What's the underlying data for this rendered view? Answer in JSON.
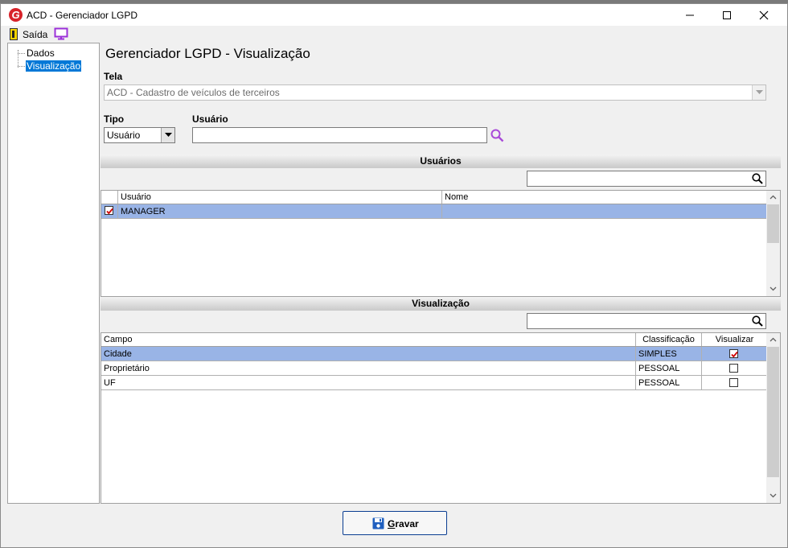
{
  "window": {
    "title": "ACD - Gerenciador LGPD",
    "logo_letter": "G",
    "controls": [
      "minimize-icon",
      "maximize-icon",
      "close-icon"
    ]
  },
  "toolbar": {
    "exit_label": "Saída",
    "icons": [
      "exit-icon",
      "monitor-icon"
    ]
  },
  "sidebar": {
    "items": [
      {
        "label": "Dados",
        "selected": false
      },
      {
        "label": "Visualização",
        "selected": true
      }
    ]
  },
  "main": {
    "title": "Gerenciador LGPD - Visualização",
    "tela": {
      "label": "Tela",
      "value": "ACD - Cadastro de veículos de terceiros"
    },
    "tipo": {
      "label": "Tipo",
      "value": "Usuário"
    },
    "usuario": {
      "label": "Usuário",
      "value": ""
    }
  },
  "users_section": {
    "title": "Usuários",
    "filter_value": "",
    "columns": [
      "Usuário",
      "Nome"
    ],
    "rows": [
      {
        "checked": true,
        "usuario": "MANAGER",
        "nome": "",
        "selected": true
      }
    ]
  },
  "visualization_section": {
    "title": "Visualização",
    "filter_value": "",
    "columns": [
      "Campo",
      "Classificação",
      "Visualizar"
    ],
    "rows": [
      {
        "campo": "Cidade",
        "classificacao": "SIMPLES",
        "visualizar": true,
        "selected": true
      },
      {
        "campo": "Proprietário",
        "classificacao": "PESSOAL",
        "visualizar": false,
        "selected": false
      },
      {
        "campo": "UF",
        "classificacao": "PESSOAL",
        "visualizar": false,
        "selected": false
      }
    ]
  },
  "footer": {
    "save_label_underlined": "G",
    "save_label_rest": "ravar"
  },
  "colors": {
    "selection_row": "#99b4e6",
    "tree_selection": "#0078d7",
    "check_mark": "#d00000",
    "logo": "#d8232a",
    "lookup_icon": "#a84ad8"
  }
}
